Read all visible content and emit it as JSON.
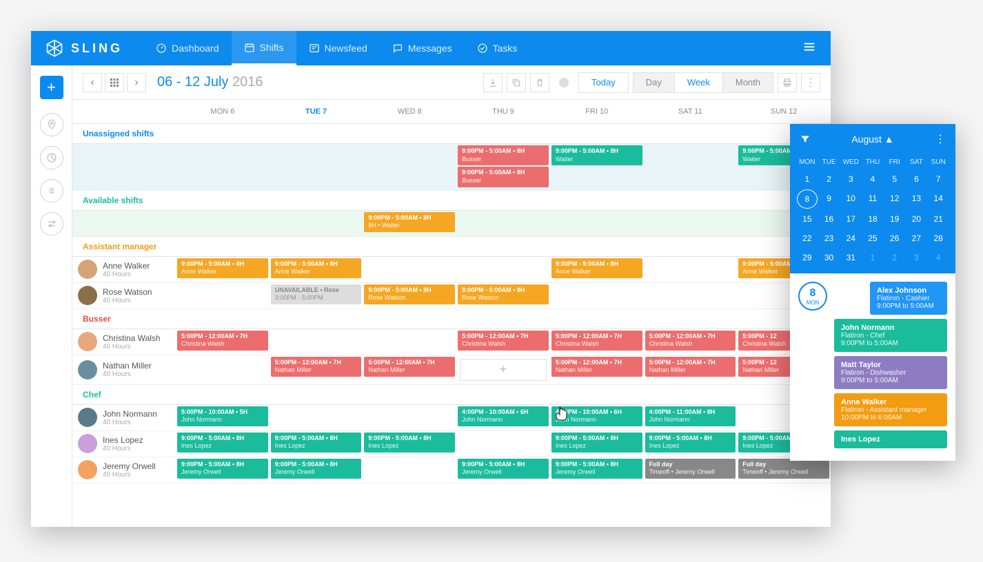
{
  "app_name": "SLING",
  "nav": {
    "dashboard": "Dashboard",
    "shifts": "Shifts",
    "newsfeed": "Newsfeed",
    "messages": "Messages",
    "tasks": "Tasks"
  },
  "toolbar": {
    "date_range": "06 - 12 July",
    "year": "2016",
    "today": "Today",
    "day": "Day",
    "week": "Week",
    "month": "Month"
  },
  "days": [
    "MON 6",
    "TUE 7",
    "WED 8",
    "THU 9",
    "FRI 10",
    "SAT 11",
    "SUN 12"
  ],
  "sections": {
    "unassigned": "Unassigned shifts",
    "available": "Available shifts",
    "assistant": "Assistant manager",
    "busser": "Busser",
    "chef": "Chef"
  },
  "unassigned_shifts": {
    "thu1": {
      "time": "9:00PM - 5:00AM • 8H",
      "sub": "Busser"
    },
    "thu2": {
      "time": "9:00PM - 5:00AM • 8H",
      "sub": "Busser"
    },
    "fri1": {
      "time": "9:00PM - 5:00AM • 8H",
      "sub": "Waiter"
    },
    "sun1": {
      "time": "9:00PM - 5:00AM",
      "sub": "Waiter"
    }
  },
  "available_shifts": {
    "wed1": {
      "time": "9:00PM - 5:00AM • 8H",
      "sub": "8H • Waiter"
    }
  },
  "people": {
    "anne": {
      "name": "Anne Walker",
      "hours": "40 Hours"
    },
    "rose": {
      "name": "Rose Watson",
      "hours": "40 Hours"
    },
    "christina": {
      "name": "Christina Walsh",
      "hours": "40 Hours"
    },
    "nathan": {
      "name": "Nathan Miller",
      "hours": "40 Hours"
    },
    "john": {
      "name": "John Normann",
      "hours": "40 Hours"
    },
    "ines": {
      "name": "Ines Lopez",
      "hours": "40 Hours"
    },
    "jeremy": {
      "name": "Jeremy Orwell",
      "hours": "40 Hours"
    }
  },
  "shifts": {
    "anne_mon": {
      "time": "9:00PM - 5:00AM • 8H",
      "sub": "Anne Walker"
    },
    "anne_tue": {
      "time": "9:00PM - 5:00AM • 8H",
      "sub": "Anne Walker"
    },
    "anne_fri": {
      "time": "9:00PM - 5:00AM • 8H",
      "sub": "Anne Walker"
    },
    "anne_sun": {
      "time": "9:00PM - 5:00AM",
      "sub": "Anne Walker"
    },
    "rose_unavail": {
      "time": "UNAVAILABLE • Rose",
      "sub": "3:00PM - 5:00PM"
    },
    "rose_wed": {
      "time": "9:00PM - 5:00AM • 8H",
      "sub": "Rose Watson"
    },
    "rose_thu": {
      "time": "9:00PM - 5:00AM • 8H",
      "sub": "Rose Watson"
    },
    "christina_mon": {
      "time": "5:00PM - 12:00AM • 7H",
      "sub": "Christina Walsh"
    },
    "christina_thu": {
      "time": "5:00PM - 12:00AM • 7H",
      "sub": "Christina Walsh"
    },
    "christina_fri": {
      "time": "5:00PM - 12:00AM • 7H",
      "sub": "Christina Walsh"
    },
    "christina_sat": {
      "time": "5:00PM - 12:00AM • 7H",
      "sub": "Christina Walsh"
    },
    "christina_sun": {
      "time": "5:00PM - 12",
      "sub": "Christina Walsh"
    },
    "nathan_tue": {
      "time": "5:00PM - 12:00AM • 7H",
      "sub": "Nathan Miller"
    },
    "nathan_wed": {
      "time": "5:00PM - 12:00AM • 7H",
      "sub": "Nathan Miller"
    },
    "nathan_fri": {
      "time": "5:00PM - 12:00AM • 7H",
      "sub": "Nathan Miller"
    },
    "nathan_sat": {
      "time": "5:00PM - 12:00AM • 7H",
      "sub": "Nathan Miller"
    },
    "nathan_sun": {
      "time": "5:00PM - 12",
      "sub": "Nathan Miller"
    },
    "john_mon": {
      "time": "5:00PM - 10:00AM • 5H",
      "sub": "John Normann"
    },
    "john_thu": {
      "time": "4:00PM - 10:00AM • 6H",
      "sub": "John Normann"
    },
    "john_fri": {
      "time": "4:00PM - 10:00AM • 6H",
      "sub": "John Normann"
    },
    "john_sat": {
      "time": "4:00PM - 11:00AM • 8H",
      "sub": "John Normann"
    },
    "ines_mon": {
      "time": "9:00PM - 5:00AM • 8H",
      "sub": "Ines Lopez"
    },
    "ines_tue": {
      "time": "9:00PM - 5:00AM • 8H",
      "sub": "Ines Lopez"
    },
    "ines_wed": {
      "time": "9:00PM - 5:00AM • 8H",
      "sub": "Ines Lopez"
    },
    "ines_fri": {
      "time": "9:00PM - 5:00AM • 8H",
      "sub": "Ines Lopez"
    },
    "ines_sat": {
      "time": "9:00PM - 5:00AM • 8H",
      "sub": "Ines Lopez"
    },
    "ines_sun": {
      "time": "9:00PM - 5:00AM",
      "sub": "Ines Lopez"
    },
    "jeremy_mon": {
      "time": "9:00PM - 5:00AM • 8H",
      "sub": "Jeremy Orwell"
    },
    "jeremy_tue": {
      "time": "9:00PM - 5:00AM • 8H",
      "sub": "Jeremy Orwell"
    },
    "jeremy_thu": {
      "time": "9:00PM - 5:00AM • 8H",
      "sub": "Jeremy Orwell"
    },
    "jeremy_fri": {
      "time": "9:00PM - 5:00AM • 8H",
      "sub": "Jeremy Orwell"
    },
    "jeremy_sat": {
      "time": "Full day",
      "sub": "Timeoff • Jeremy Orwell"
    },
    "jeremy_sun": {
      "time": "Full day",
      "sub": "Timeoff • Jeremy Orwell"
    }
  },
  "calendar": {
    "month": "August ▲",
    "days": [
      "MON",
      "TUE",
      "WED",
      "THU",
      "FRI",
      "SAT",
      "SUN"
    ],
    "dates": [
      [
        1,
        2,
        3,
        4,
        5,
        6,
        7
      ],
      [
        8,
        9,
        10,
        11,
        12,
        13,
        14
      ],
      [
        15,
        16,
        17,
        18,
        19,
        20,
        21
      ],
      [
        22,
        23,
        24,
        25,
        26,
        27,
        28
      ],
      [
        29,
        30,
        31,
        1,
        2,
        3,
        4
      ]
    ],
    "selected": 8,
    "badge_day": "8",
    "badge_mon": "MON"
  },
  "sidepanel_shifts": [
    {
      "name": "Alex Johnson",
      "loc": "Flatiron - Cashier",
      "time": "9:00PM to 5:00AM",
      "cls": "sp-blue"
    },
    {
      "name": "John Normann",
      "loc": "Flatiron - Chef",
      "time": "9:00PM to 5:00AM",
      "cls": "sp-teal"
    },
    {
      "name": "Matt Taylor",
      "loc": "Flatiron - Dishwasher",
      "time": "9:00PM to 5:00AM",
      "cls": "sp-purple"
    },
    {
      "name": "Anne Walker",
      "loc": "Flatiron - Assistant manager",
      "time": "10:00PM to 6:00AM",
      "cls": "sp-orange"
    },
    {
      "name": "Ines Lopez",
      "loc": "",
      "time": "",
      "cls": "sp-teal2"
    }
  ]
}
